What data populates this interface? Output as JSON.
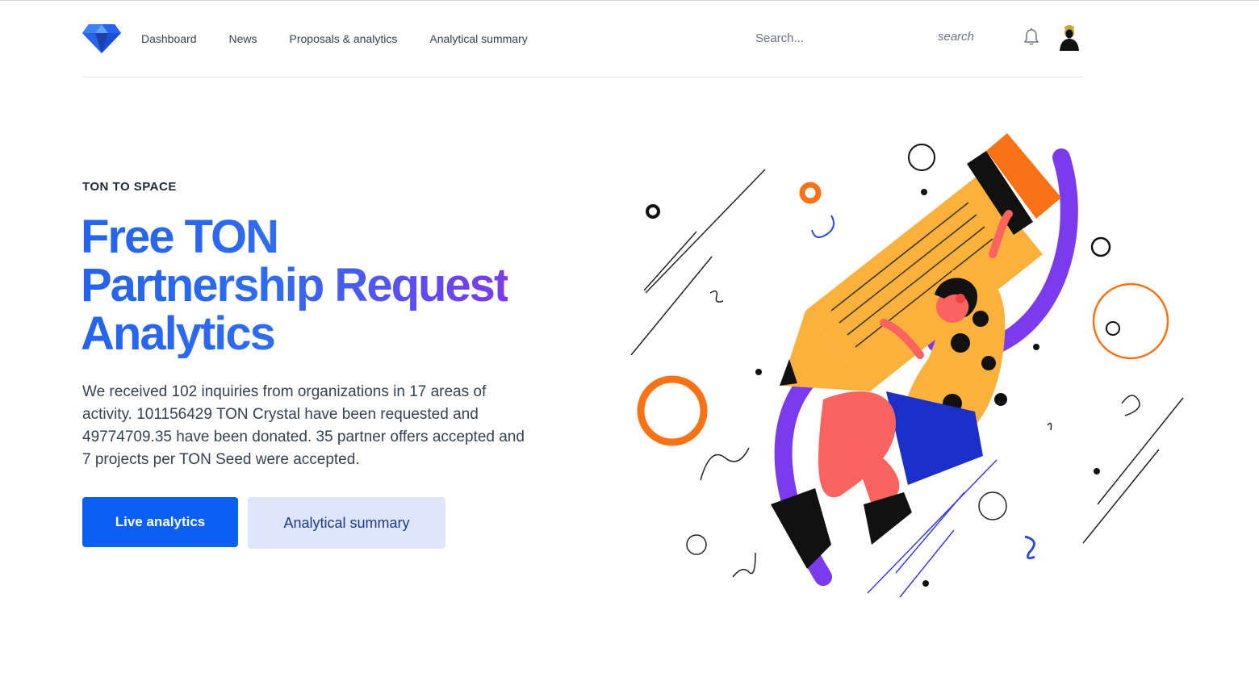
{
  "header": {
    "nav": [
      {
        "label": "Dashboard"
      },
      {
        "label": "News"
      },
      {
        "label": "Proposals & analytics"
      },
      {
        "label": "Analytical summary"
      }
    ],
    "search": {
      "placeholder": "Search...",
      "button_label": "search"
    }
  },
  "hero": {
    "eyebrow": "TON TO SPACE",
    "headline": [
      "Free TON",
      "Partnership Request",
      "Analytics"
    ],
    "description": "We received 102 inquiries from organizations in 17 areas of activity. 101156429 TON Crystal have been requested and 49774709.35 have been donated. 35 partner offers accepted and 7 projects per TON Seed were accepted.",
    "primary_button": "Live analytics",
    "secondary_button": "Analytical summary"
  },
  "colors": {
    "accent": "#0a5ff5",
    "secondary_bg": "#dfe5fb",
    "headline_gradient": [
      "#2563eb",
      "#7c3aed"
    ],
    "illustration": {
      "yellow": "#fbb13c",
      "orange": "#f97316",
      "purple": "#7c3aed",
      "coral": "#fb6361",
      "blue": "#1d2fc9"
    }
  },
  "icons": [
    "diamond-logo-icon",
    "bell-icon",
    "avatar-icon"
  ]
}
